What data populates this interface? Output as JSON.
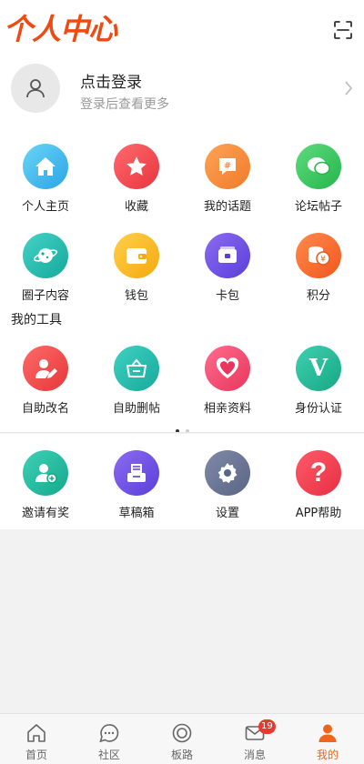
{
  "header": {
    "brand": "个人中心"
  },
  "login": {
    "title": "点击登录",
    "subtitle": "登录后查看更多"
  },
  "grid_main": [
    {
      "label": "个人主页"
    },
    {
      "label": "收藏"
    },
    {
      "label": "我的话题"
    },
    {
      "label": "论坛帖子"
    },
    {
      "label": "圈子内容"
    },
    {
      "label": "钱包"
    },
    {
      "label": "卡包"
    },
    {
      "label": "积分"
    }
  ],
  "tools": {
    "title": "我的工具",
    "items": [
      {
        "label": "自助改名"
      },
      {
        "label": "自助删帖"
      },
      {
        "label": "相亲资料"
      },
      {
        "label": "身份认证"
      }
    ]
  },
  "extras": [
    {
      "label": "邀请有奖"
    },
    {
      "label": "草稿箱"
    },
    {
      "label": "设置"
    },
    {
      "label": "APP帮助"
    }
  ],
  "tabbar": {
    "items": [
      {
        "label": "首页"
      },
      {
        "label": "社区"
      },
      {
        "label": "板路"
      },
      {
        "label": "消息",
        "badge": "19"
      },
      {
        "label": "我的"
      }
    ]
  },
  "icons": {
    "v_glyph": "V",
    "hash_glyph": "#",
    "yen_glyph": "¥",
    "question_glyph": "?"
  },
  "colors": {
    "brand": "#f04a12",
    "accent": "#f0651e",
    "badge": "#e73a2e"
  }
}
